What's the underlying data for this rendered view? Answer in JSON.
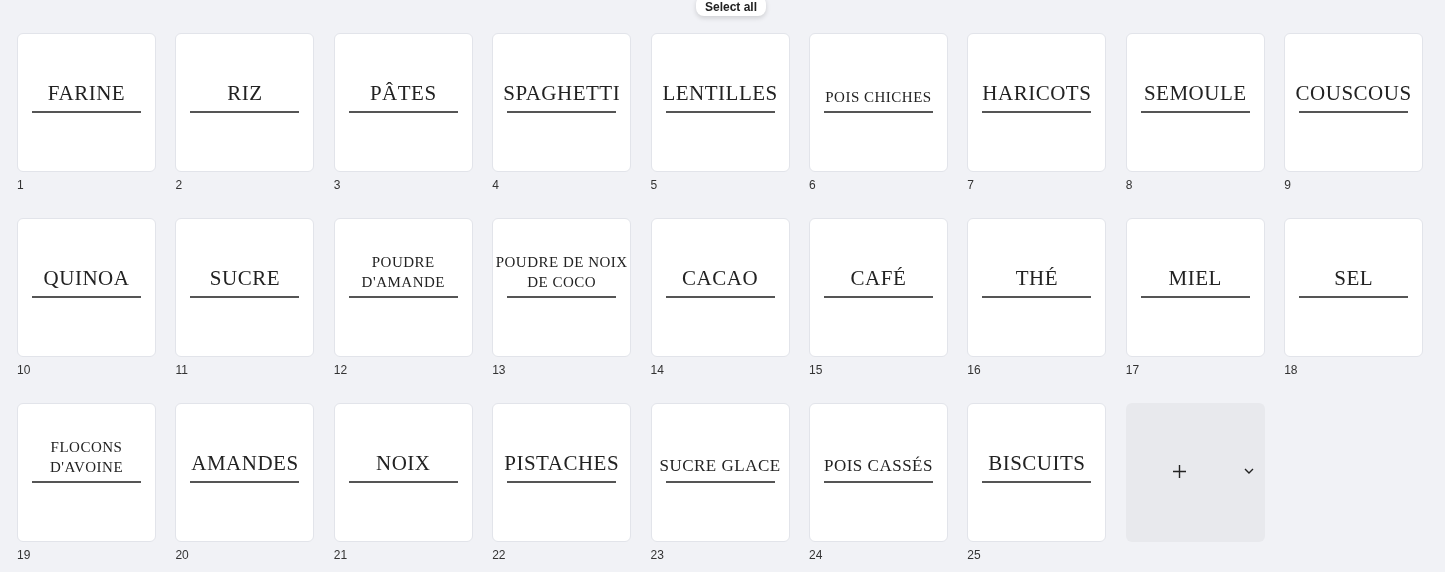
{
  "toolbar": {
    "select_all": "Select all"
  },
  "pages": [
    {
      "title": "FARINE",
      "number": "1"
    },
    {
      "title": "RIZ",
      "number": "2"
    },
    {
      "title": "PÂTES",
      "number": "3"
    },
    {
      "title": "SPAGHETTI",
      "number": "4"
    },
    {
      "title": "LENTILLES",
      "number": "5"
    },
    {
      "title": "POIS CHICHES",
      "number": "6"
    },
    {
      "title": "HARICOTS",
      "number": "7"
    },
    {
      "title": "SEMOULE",
      "number": "8"
    },
    {
      "title": "COUSCOUS",
      "number": "9"
    },
    {
      "title": "QUINOA",
      "number": "10"
    },
    {
      "title": "SUCRE",
      "number": "11"
    },
    {
      "title": "POUDRE D'AMANDE",
      "number": "12"
    },
    {
      "title": "POUDRE DE NOIX DE COCO",
      "number": "13"
    },
    {
      "title": "CACAO",
      "number": "14"
    },
    {
      "title": "CAFÉ",
      "number": "15"
    },
    {
      "title": "THÉ",
      "number": "16"
    },
    {
      "title": "MIEL",
      "number": "17"
    },
    {
      "title": "SEL",
      "number": "18"
    },
    {
      "title": "FLOCONS D'AVOINE",
      "number": "19"
    },
    {
      "title": "AMANDES",
      "number": "20"
    },
    {
      "title": "NOIX",
      "number": "21"
    },
    {
      "title": "PISTACHES",
      "number": "22"
    },
    {
      "title": "SUCRE GLACE",
      "number": "23"
    },
    {
      "title": "POIS CASSÉS",
      "number": "24"
    },
    {
      "title": "BISCUITS",
      "number": "25"
    }
  ]
}
